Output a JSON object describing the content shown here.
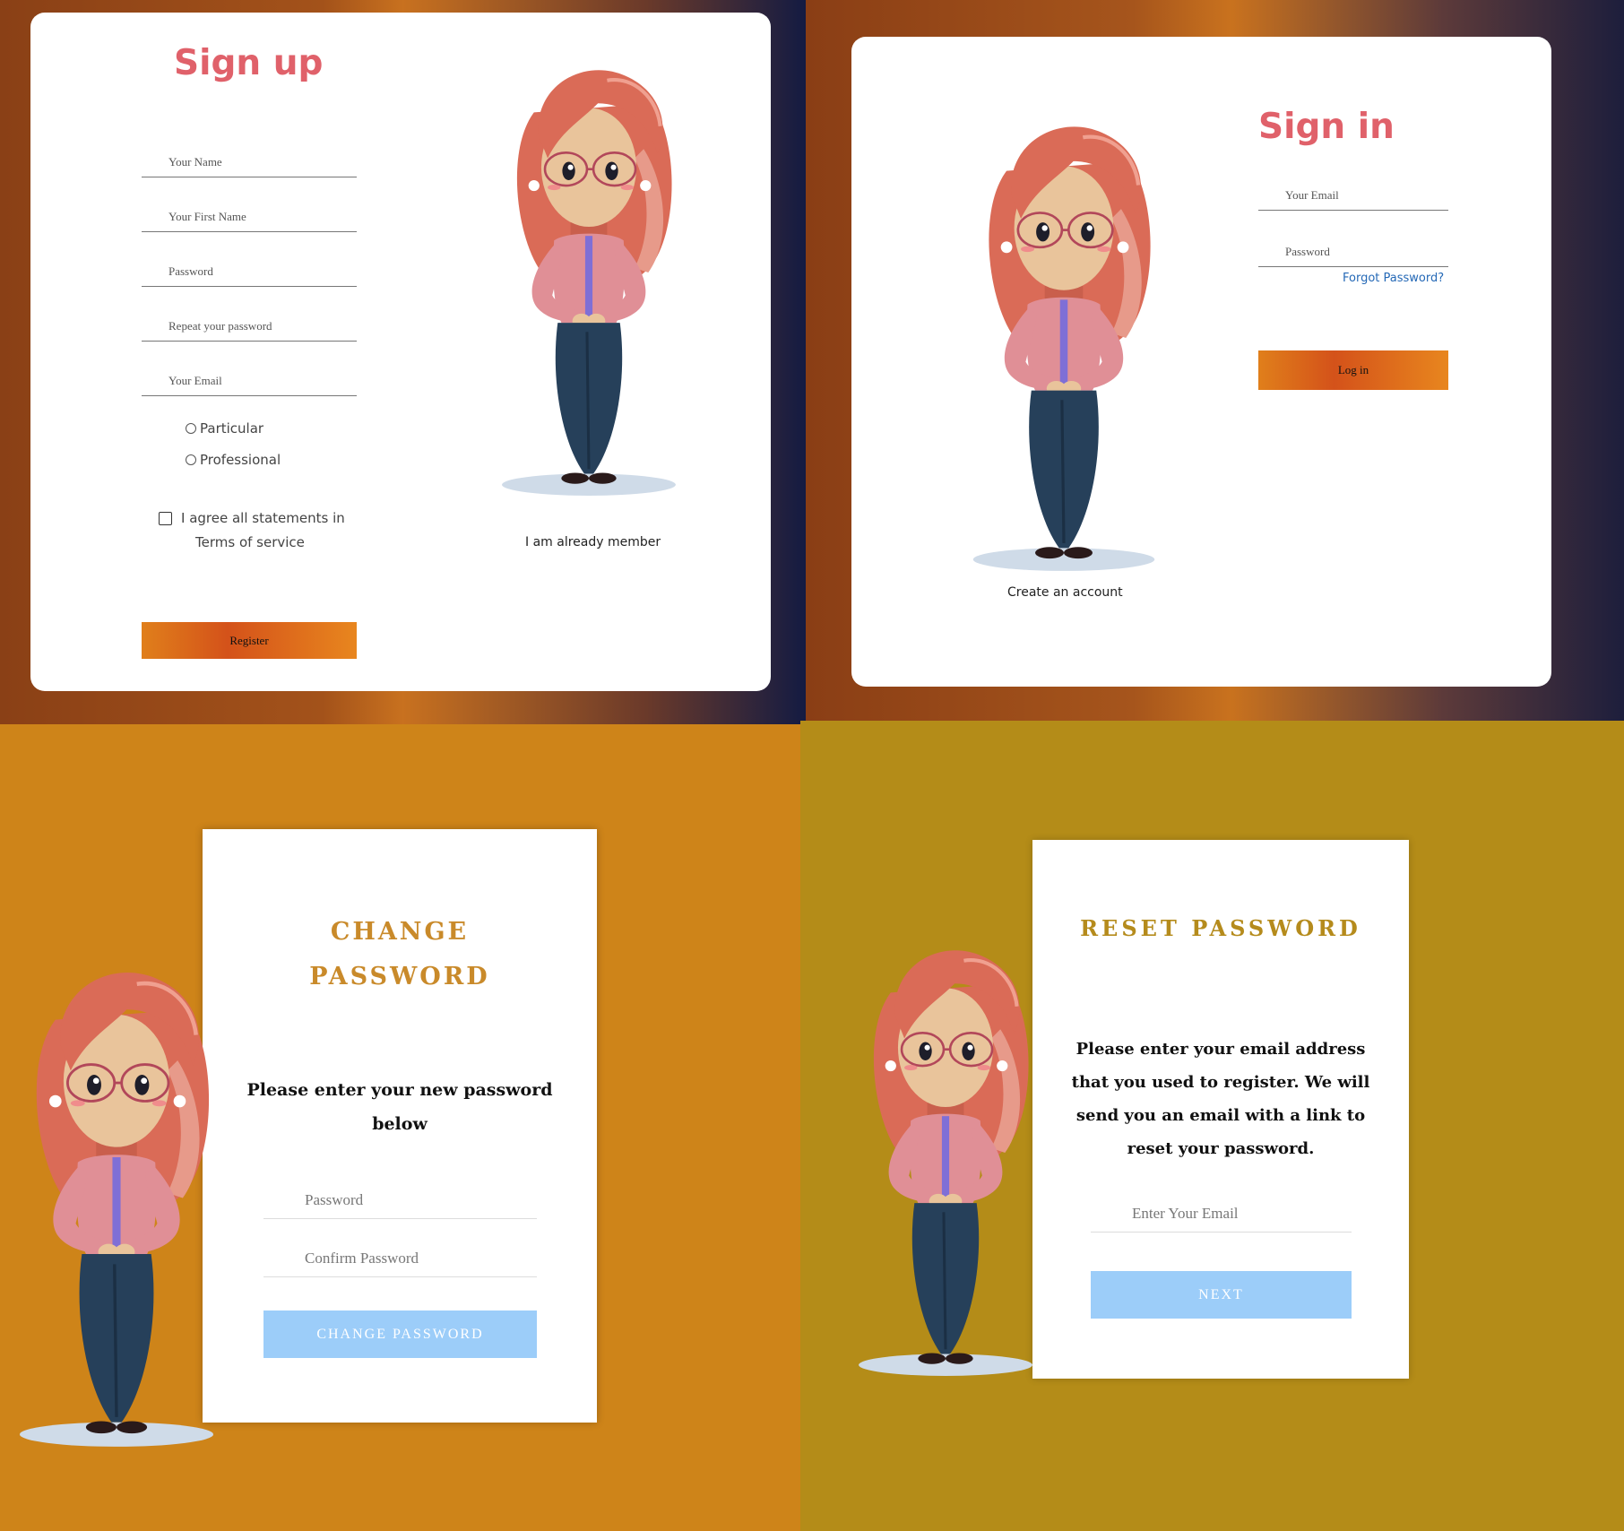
{
  "colors": {
    "title_pink": "#e0616a",
    "title_gold": "#c98a2a",
    "title_gold_reset": "#b58b1c",
    "link_blue": "#2468b6",
    "button_blue": "#9ccdf9",
    "panel_orange": "#ce8419",
    "panel_olive": "#b48c18"
  },
  "signup": {
    "title": "Sign up",
    "fields": [
      {
        "placeholder": "Your Name"
      },
      {
        "placeholder": "Your First Name"
      },
      {
        "placeholder": "Password"
      },
      {
        "placeholder": "Repeat your password"
      },
      {
        "placeholder": "Your Email"
      }
    ],
    "radios": [
      {
        "label": "Particular",
        "checked": false
      },
      {
        "label": "Professional",
        "checked": false
      }
    ],
    "agree_line1": "I agree all statements in",
    "agree_line2": "Terms of service",
    "register_label": "Register",
    "already_member": "I am already member",
    "illustration": "girl-with-glasses-illustration"
  },
  "signin": {
    "title": "Sign in",
    "fields": [
      {
        "placeholder": "Your Email"
      },
      {
        "placeholder": "Password"
      }
    ],
    "forgot": "Forgot Password?",
    "login_label": "Log in",
    "create_account": "Create an account",
    "illustration": "girl-with-glasses-illustration"
  },
  "change_password": {
    "title_line1": "CHANGE",
    "title_line2": "PASSWORD",
    "instruction_line1": "Please enter your new password",
    "instruction_line2": "below",
    "fields": [
      {
        "placeholder": "Password"
      },
      {
        "placeholder": "Confirm Password"
      }
    ],
    "button_label": "CHANGE PASSWORD",
    "illustration": "girl-with-glasses-illustration"
  },
  "reset_password": {
    "title": "RESET PASSWORD",
    "instruction_lines": [
      "Please enter your email address",
      "that you used to register. We will",
      "send you an email with a link to",
      "reset your password."
    ],
    "field": {
      "placeholder": "Enter Your Email"
    },
    "button_label": "NEXT",
    "illustration": "girl-with-glasses-illustration"
  }
}
